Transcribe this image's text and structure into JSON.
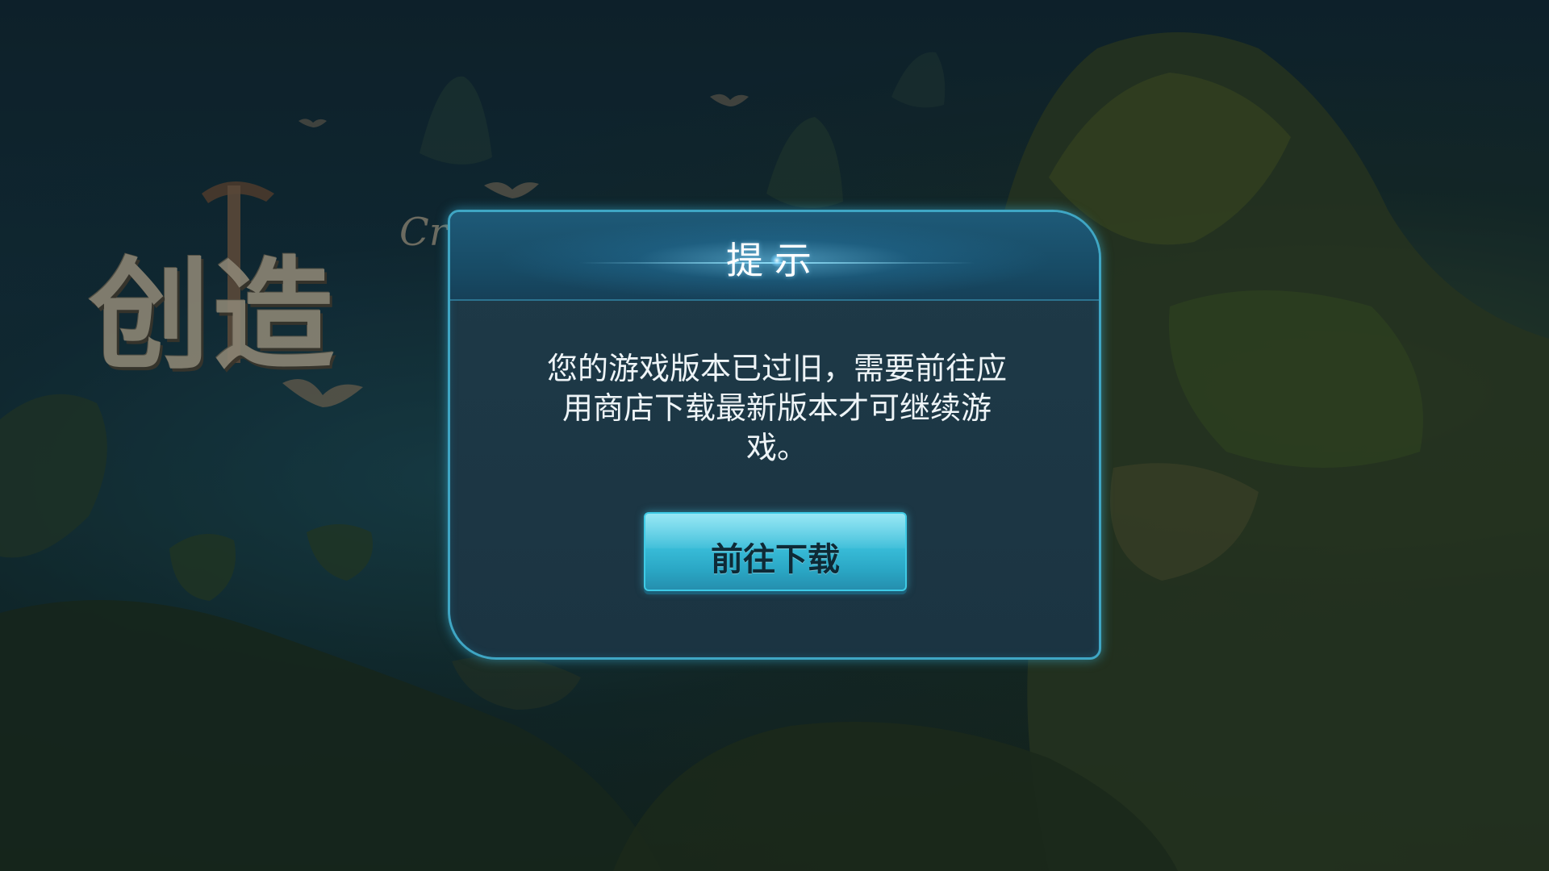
{
  "game": {
    "logo_title": "创造",
    "logo_subtitle": "Cr"
  },
  "dialog": {
    "title": "提示",
    "message": "您的游戏版本已过旧，需要前往应用商店下载最新版本才可继续游戏。",
    "button_label": "前往下载"
  },
  "colors": {
    "dialog_border": "#3fa6c4",
    "dialog_header": "#1e5a78",
    "dialog_body": "#1b3442",
    "button": "#38bcd8",
    "button_text": "#0e2a36"
  },
  "icons": {
    "logo_pickaxe": "pickaxe-icon"
  }
}
